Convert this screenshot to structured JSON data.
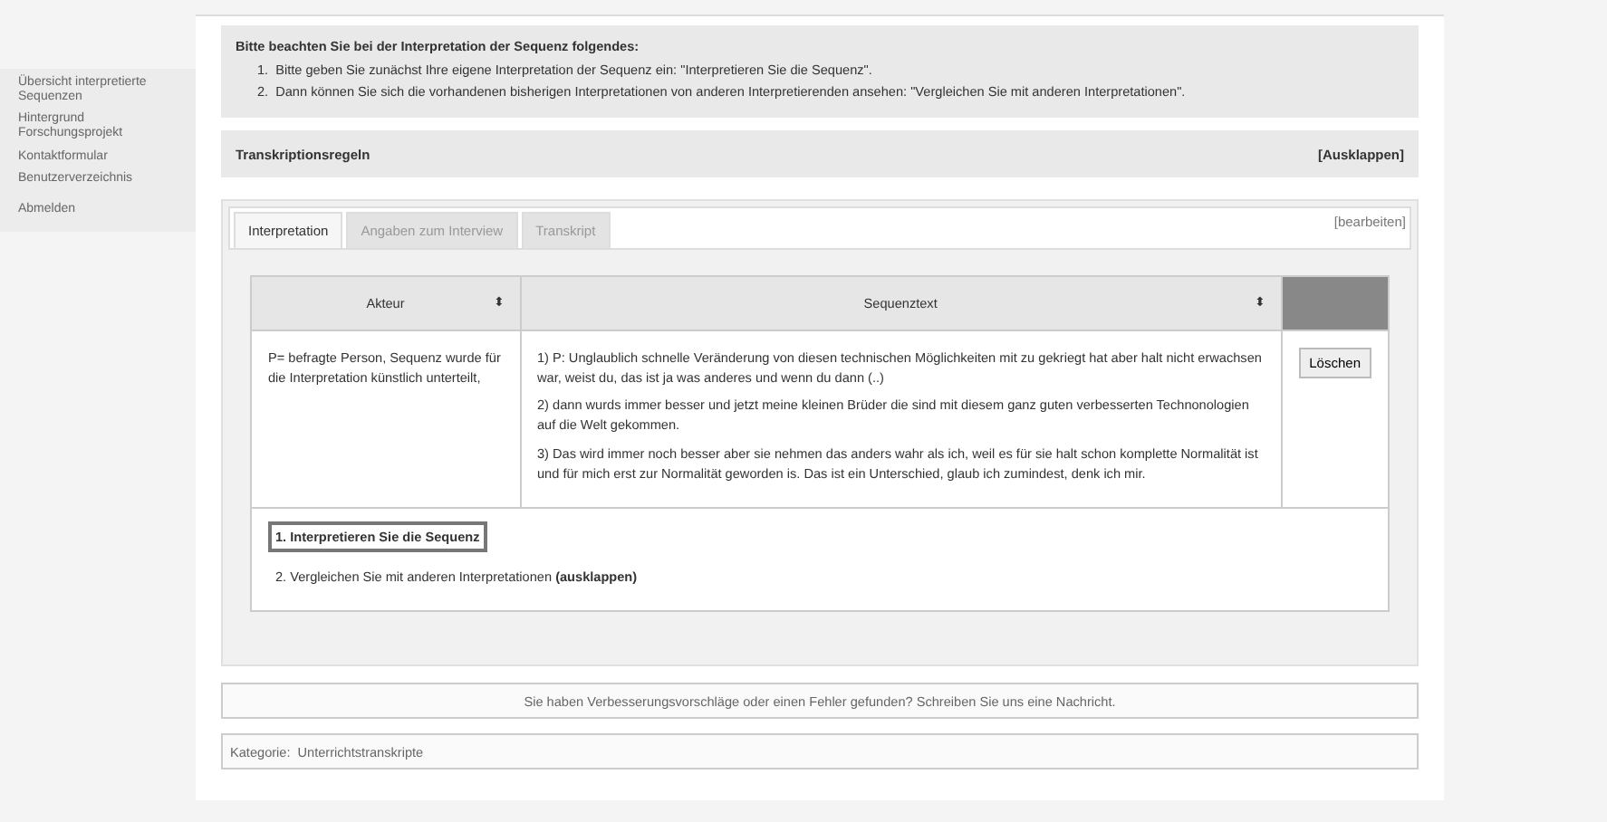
{
  "sidebar": {
    "items": [
      {
        "label": "Übersicht interpretierte Sequenzen"
      },
      {
        "label": "Hintergrund Forschungsprojekt"
      },
      {
        "label": "Kontaktformular"
      },
      {
        "label": "Benutzerverzeichnis"
      },
      {
        "label": "Abmelden"
      }
    ]
  },
  "notice": {
    "title": "Bitte beachten Sie bei der Interpretation der Sequenz folgendes:",
    "items": [
      "Bitte geben Sie zunächst Ihre eigene Interpretation der Sequenz ein: \"Interpretieren Sie die Sequenz\".",
      "Dann können Sie sich die vorhandenen bisherigen Interpretationen von anderen Interpretierenden ansehen: \"Vergleichen Sie mit anderen Interpretationen\"."
    ],
    "markers": [
      "1.",
      "2."
    ]
  },
  "rules_bar": {
    "title": "Transkriptionsregeln",
    "action": "[Ausklappen]"
  },
  "tabs": [
    {
      "label": "Interpretation",
      "selected": true
    },
    {
      "label": "Angaben zum Interview",
      "selected": false
    },
    {
      "label": "Transkript",
      "selected": false
    }
  ],
  "edit_link": "[bearbeiten]",
  "table": {
    "columns": [
      {
        "label": "Akteur",
        "sort_icon": "⬍"
      },
      {
        "label": "Sequenztext",
        "sort_icon": "⬍"
      }
    ],
    "rows": [
      {
        "actor": "P= befragte Person, Sequenz wurde für die Interpretation künstlich unterteilt,",
        "paragraphs": [
          "1) P: Unglaublich schnelle Veränderung von diesen technischen Möglichkeiten mit zu gekriegt hat aber halt nicht erwachsen war, weist du, das ist ja was anderes und wenn du dann (..)",
          "2) dann wurds immer besser und jetzt meine kleinen Brüder die sind mit diesem ganz guten verbesserten Technonologien auf die Welt gekommen.",
          "3) Das wird immer noch besser aber sie nehmen das anders wahr als ich, weil es für sie halt schon komplette Normalität ist und für mich erst zur Normalität geworden is. Das ist ein Unterschied, glaub ich zumindest, denk ich mir."
        ],
        "button": "Löschen"
      }
    ]
  },
  "steps": [
    {
      "label": "1. Interpretieren Sie die Sequenz",
      "selected": true
    },
    {
      "label": "2. Vergleichen Sie mit anderen Interpretationen **(ausklappen)**",
      "selected": false
    }
  ],
  "feedback": "Sie haben Verbesserungsvorschläge oder einen Fehler gefunden? Schreiben Sie uns eine Nachricht.",
  "category": {
    "label": "Kategorie:",
    "value": "Unterrichtstranskripte"
  }
}
